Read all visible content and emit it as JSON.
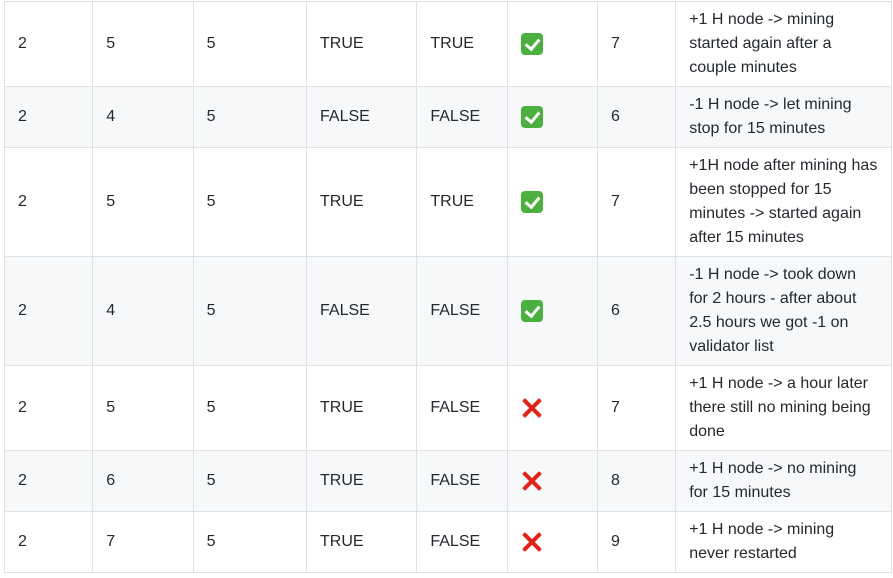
{
  "table": {
    "rows": [
      {
        "c1": "2",
        "c2": "5",
        "c3": "5",
        "c4": "TRUE",
        "c5": "TRUE",
        "status": "check-mark-icon",
        "c7": "7",
        "note": "+1 H node -> mining started again after a couple minutes"
      },
      {
        "c1": "2",
        "c2": "4",
        "c3": "5",
        "c4": "FALSE",
        "c5": "FALSE",
        "status": "check-mark-icon",
        "c7": "6",
        "note": "-1 H node -> let mining stop for 15 minutes"
      },
      {
        "c1": "2",
        "c2": "5",
        "c3": "5",
        "c4": "TRUE",
        "c5": "TRUE",
        "status": "check-mark-icon",
        "c7": "7",
        "note": "+1H node after mining has been stopped for 15 minutes -> started again after 15 minutes"
      },
      {
        "c1": "2",
        "c2": "4",
        "c3": "5",
        "c4": "FALSE",
        "c5": "FALSE",
        "status": "check-mark-icon",
        "c7": "6",
        "note": "-1 H node -> took down for 2 hours - after about 2.5 hours we got -1 on validator list"
      },
      {
        "c1": "2",
        "c2": "5",
        "c3": "5",
        "c4": "TRUE",
        "c5": "FALSE",
        "status": "cross-mark-icon",
        "c7": "7",
        "note": "+1 H node -> a hour later there still no mining being done"
      },
      {
        "c1": "2",
        "c2": "6",
        "c3": "5",
        "c4": "TRUE",
        "c5": "FALSE",
        "status": "cross-mark-icon",
        "c7": "8",
        "note": "+1 H node -> no mining for 15 minutes"
      },
      {
        "c1": "2",
        "c2": "7",
        "c3": "5",
        "c4": "TRUE",
        "c5": "FALSE",
        "status": "cross-mark-icon",
        "c7": "9",
        "note": "+1 H node -> mining never restarted"
      }
    ]
  },
  "colors": {
    "check_green": "#4cb040",
    "cross_red": "#e2231a",
    "row_alt": "#f6f8fa",
    "border": "#dfe2e5"
  }
}
